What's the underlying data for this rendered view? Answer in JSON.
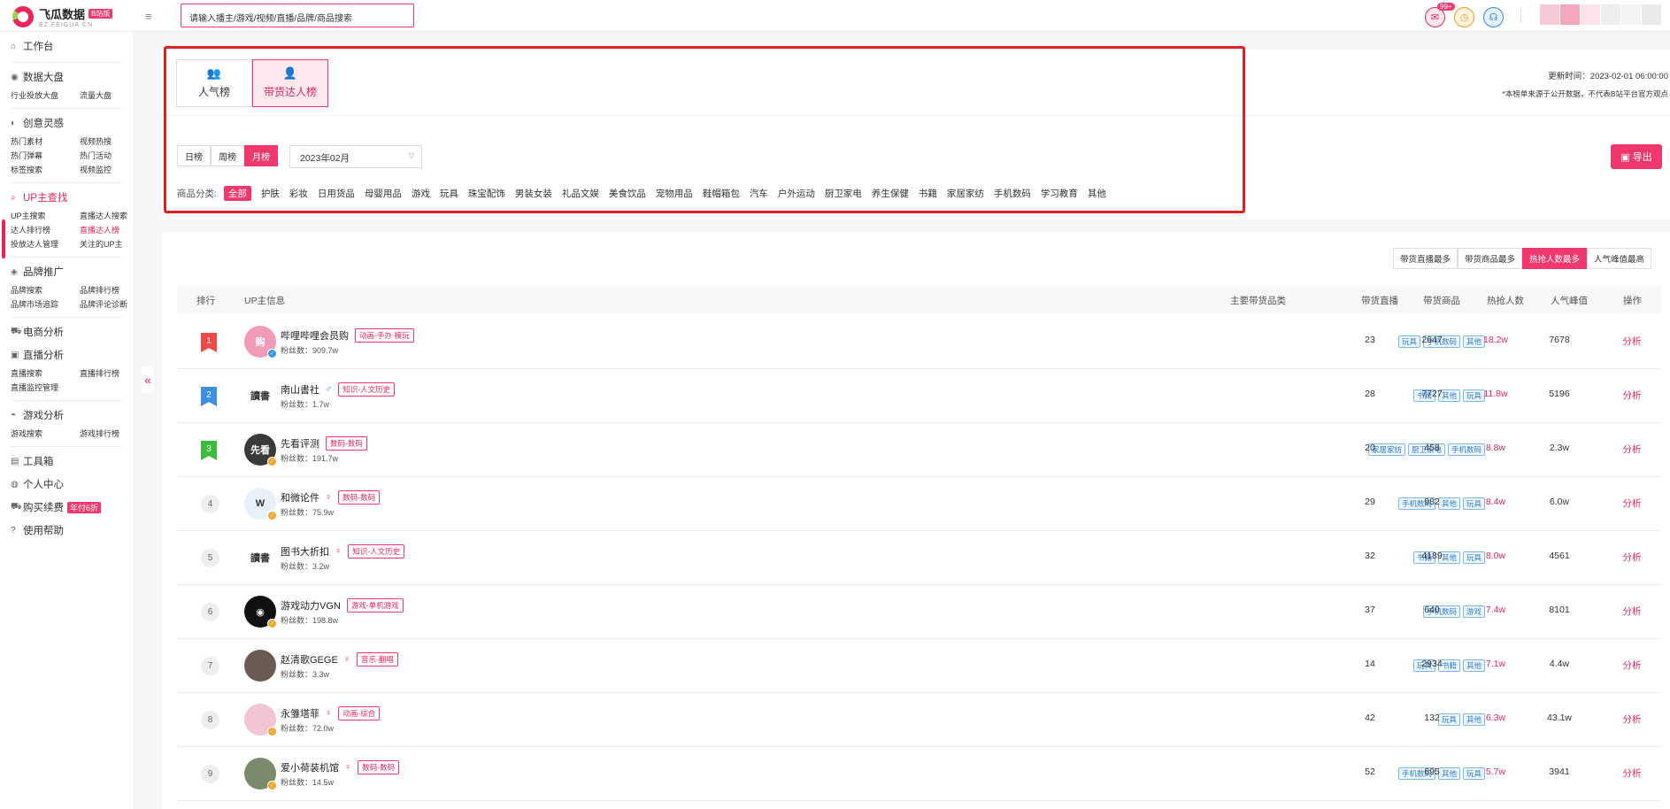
{
  "header": {
    "logo_title": "飞瓜数据",
    "logo_badge": "B站版",
    "logo_sub": "BZ.FEIGUA.CN",
    "menu_icon": "≡",
    "search_placeholder": "请输入播主/游戏/视频/直播/品牌/商品搜索",
    "msg_count": "99+"
  },
  "sidebar": {
    "groups": [
      {
        "label": "工作台",
        "icon": "home-icon",
        "items": []
      },
      {
        "label": "数据大盘",
        "icon": "dashboard-icon",
        "items": [
          "行业投放大盘",
          "流量大盘"
        ]
      },
      {
        "label": "创意灵感",
        "icon": "bulb-icon",
        "items": [
          "热门素材",
          "视频热搜",
          "热门弹幕",
          "热门活动",
          "标签搜索",
          "视频监控"
        ]
      },
      {
        "label": "UP主查找",
        "icon": "search-icon",
        "items": [
          "UP主搜索",
          "直播达人搜索",
          "达人排行榜",
          "直播达人榜",
          "投放达人管理",
          "关注的UP主"
        ]
      },
      {
        "label": "品牌推广",
        "icon": "brand-icon",
        "items": [
          "品牌搜索",
          "品牌排行榜",
          "品牌市场追踪",
          "品牌评论诊断"
        ]
      },
      {
        "label": "电商分析",
        "icon": "cart-icon",
        "items": []
      },
      {
        "label": "直播分析",
        "icon": "live-icon",
        "items": [
          "直播搜索",
          "直播排行榜",
          "直播监控管理"
        ]
      },
      {
        "label": "游戏分析",
        "icon": "game-icon",
        "items": [
          "游戏搜索",
          "游戏排行榜"
        ]
      },
      {
        "label": "工具箱",
        "icon": "toolbox-icon",
        "items": []
      },
      {
        "label": "个人中心",
        "icon": "user-icon",
        "items": []
      },
      {
        "label": "购买续费",
        "icon": "cart-icon",
        "items": [],
        "promo": "年付6折"
      },
      {
        "label": "使用帮助",
        "icon": "help-icon",
        "items": []
      }
    ],
    "active_group": "UP主查找",
    "active_item": "直播达人榜"
  },
  "filters": {
    "mode_tabs": [
      "人气榜",
      "带货达人榜"
    ],
    "active_mode": "带货达人榜",
    "update_time": "更新时间：2023-02-01 06:00:00",
    "disclaimer": "*本榜单来源于公开数据，不代表B站平台官方观点",
    "period_tabs": [
      "日榜",
      "周榜",
      "月榜"
    ],
    "active_period": "月榜",
    "month_value": "2023年02月",
    "export_label": "导出",
    "category_label": "商品分类:",
    "categories": [
      "全部",
      "护肤",
      "彩妆",
      "日用货品",
      "母婴用品",
      "游戏",
      "玩具",
      "珠宝配饰",
      "男装女装",
      "礼品文娱",
      "美食饮品",
      "宠物用品",
      "鞋帽箱包",
      "汽车",
      "户外运动",
      "厨卫家电",
      "养生保健",
      "书籍",
      "家居家纺",
      "手机数码",
      "学习教育",
      "其他"
    ],
    "active_category": "全部"
  },
  "table": {
    "sort_tabs": [
      "带货直播最多",
      "带货商品最多",
      "热抢人数最多",
      "人气峰值最高"
    ],
    "active_sort": "热抢人数最多",
    "headers": {
      "rank": "排行",
      "info": "UP主信息",
      "cats": "主要带货品类",
      "lives": "带货直播",
      "goods": "带货商品",
      "buyers": "热抢人数",
      "peak": "人气峰值",
      "op": "操作"
    },
    "fans_prefix": "粉丝数：",
    "rows": [
      {
        "rank": "1",
        "name": "哔哩哔哩会员购",
        "gender": "",
        "tag": "动画-手办·模玩",
        "fans": "909.7w",
        "cats": [
          "玩具",
          "手机数码",
          "其他"
        ],
        "lives": "23",
        "goods": "2647",
        "buyers": "18.2w",
        "peak": "7678",
        "op": "分析",
        "avatar_text": "购",
        "avatar_color": "#f29bb8",
        "badge_color": "#2e9be6"
      },
      {
        "rank": "2",
        "name": "南山書社",
        "gender": "♂",
        "tag": "知识-人文历史",
        "fans": "1.7w",
        "cats": [
          "书籍",
          "其他",
          "玩具"
        ],
        "lives": "28",
        "goods": "7727",
        "buyers": "11.8w",
        "peak": "5196",
        "op": "分析",
        "avatar_text": "讀書",
        "avatar_color": "#ffffff",
        "badge_color": ""
      },
      {
        "rank": "3",
        "name": "先看评测",
        "gender": "",
        "tag": "数码-数码",
        "fans": "191.7w",
        "cats": [
          "家居家纺",
          "厨卫家电",
          "手机数码"
        ],
        "lives": "20",
        "goods": "458",
        "buyers": "8.8w",
        "peak": "2.3w",
        "op": "分析",
        "avatar_text": "先看",
        "avatar_color": "#3a3a3a",
        "badge_color": "#f5a623"
      },
      {
        "rank": "4",
        "name": "和微论件",
        "gender": "♀",
        "tag": "数码-数码",
        "fans": "75.9w",
        "cats": [
          "手机数码",
          "其他",
          "玩具"
        ],
        "lives": "29",
        "goods": "982",
        "buyers": "8.4w",
        "peak": "6.0w",
        "op": "分析",
        "avatar_text": "W",
        "avatar_color": "#e8f1fb",
        "badge_color": "#f5a623"
      },
      {
        "rank": "5",
        "name": "图书大折扣",
        "gender": "♀",
        "tag": "知识-人文历史",
        "fans": "3.2w",
        "cats": [
          "书籍",
          "其他",
          "玩具"
        ],
        "lives": "32",
        "goods": "4189",
        "buyers": "8.0w",
        "peak": "4561",
        "op": "分析",
        "avatar_text": "讀書",
        "avatar_color": "#ffffff",
        "badge_color": ""
      },
      {
        "rank": "6",
        "name": "游戏动力VGN",
        "gender": "",
        "tag": "游戏-单机游戏",
        "fans": "198.8w",
        "cats": [
          "手机数码",
          "游戏"
        ],
        "lives": "37",
        "goods": "640",
        "buyers": "7.4w",
        "peak": "8101",
        "op": "分析",
        "avatar_text": "◉",
        "avatar_color": "#111111",
        "badge_color": "#f5a623"
      },
      {
        "rank": "7",
        "name": "赵清歌GEGE",
        "gender": "♀",
        "tag": "音乐-翻唱",
        "fans": "3.3w",
        "cats": [
          "玩具",
          "书籍",
          "其他"
        ],
        "lives": "14",
        "goods": "2934",
        "buyers": "7.1w",
        "peak": "4.4w",
        "op": "分析",
        "avatar_text": "",
        "avatar_color": "#6b5a52",
        "badge_color": ""
      },
      {
        "rank": "8",
        "name": "永雏塔菲",
        "gender": "♀",
        "tag": "动画-综合",
        "fans": "72.0w",
        "cats": [
          "玩具",
          "其他"
        ],
        "lives": "42",
        "goods": "132",
        "buyers": "6.3w",
        "peak": "43.1w",
        "op": "分析",
        "avatar_text": "",
        "avatar_color": "#f3c4d2",
        "badge_color": "#f5a623"
      },
      {
        "rank": "9",
        "name": "爱小荷装机馆",
        "gender": "♀",
        "tag": "数码-数码",
        "fans": "14.5w",
        "cats": [
          "手机数码",
          "其他",
          "玩具"
        ],
        "lives": "52",
        "goods": "695",
        "buyers": "5.7w",
        "peak": "3941",
        "op": "分析",
        "avatar_text": "",
        "avatar_color": "#7a8a6a",
        "badge_color": "#f5a623"
      }
    ]
  },
  "colors": {
    "accent": "#f1386c",
    "highlight_box": "#e02020",
    "rank1": "#f04848",
    "rank2": "#3b8fe0",
    "rank3": "#3dbd3d"
  }
}
